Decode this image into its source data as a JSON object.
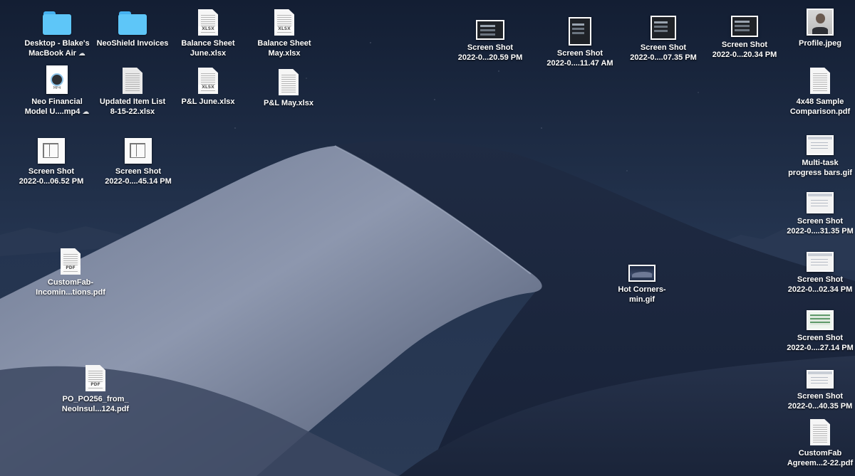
{
  "desktop": {
    "icons": {
      "desktop_folder": {
        "line1": "Desktop - Blake's",
        "line2": "MacBook Air",
        "type": "folder",
        "cloud": true
      },
      "neoshield_folder": {
        "line1": "NeoShield Invoices",
        "type": "folder"
      },
      "balance_june": {
        "line1": "Balance Sheet",
        "line2": "June.xlsx",
        "type": "xlsx",
        "badge": "XLSX"
      },
      "balance_may": {
        "line1": "Balance Sheet",
        "line2": "May.xlsx",
        "type": "xlsx",
        "badge": "XLSX"
      },
      "neo_model": {
        "line1": "Neo Financial",
        "line2": "Model U....mp4",
        "type": "mp4",
        "badge": "MP4",
        "cloud": true
      },
      "updated_item_list": {
        "line1": "Updated Item List",
        "line2": "8-15-22.xlsx",
        "type": "xlsx"
      },
      "pl_june": {
        "line1": "P&L June.xlsx",
        "type": "xlsx",
        "badge": "XLSX"
      },
      "pl_may": {
        "line1": "P&L May.xlsx",
        "type": "xlsx"
      },
      "shot_0652": {
        "line1": "Screen Shot",
        "line2": "2022-0...06.52 PM",
        "type": "screenshot"
      },
      "shot_4514": {
        "line1": "Screen Shot",
        "line2": "2022-0....45.14 PM",
        "type": "screenshot"
      },
      "customfab_incoming": {
        "line1": "CustomFab-",
        "line2": "Incomin...tions.pdf",
        "type": "pdf",
        "badge": "PDF"
      },
      "po_pdf": {
        "line1": "PO_PO256_from_",
        "line2": "NeoInsul...124.pdf",
        "type": "pdf",
        "badge": "PDF"
      },
      "shot_2059": {
        "line1": "Screen Shot",
        "line2": "2022-0...20.59 PM",
        "type": "screenshot"
      },
      "shot_1147": {
        "line1": "Screen Shot",
        "line2": "2022-0....11.47 AM",
        "type": "screenshot"
      },
      "shot_0735": {
        "line1": "Screen Shot",
        "line2": "2022-0....07.35 PM",
        "type": "screenshot"
      },
      "shot_2034": {
        "line1": "Screen Shot",
        "line2": "2022-0...20.34 PM",
        "type": "screenshot"
      },
      "profile": {
        "line1": "Profile.jpeg",
        "type": "jpeg"
      },
      "sample_pdf": {
        "line1": "4x48 Sample",
        "line2": "Comparison.pdf",
        "type": "pdf"
      },
      "multitask_gif": {
        "line1": "Multi-task",
        "line2": "progress bars.gif",
        "type": "gif"
      },
      "shot_3135": {
        "line1": "Screen Shot",
        "line2": "2022-0....31.35 PM",
        "type": "screenshot"
      },
      "shot_0234": {
        "line1": "Screen Shot",
        "line2": "2022-0...02.34 PM",
        "type": "screenshot"
      },
      "shot_2714": {
        "line1": "Screen Shot",
        "line2": "2022-0....27.14 PM",
        "type": "screenshot"
      },
      "shot_4035": {
        "line1": "Screen Shot",
        "line2": "2022-0...40.35 PM",
        "type": "screenshot"
      },
      "customfab_agreement": {
        "line1": "CustomFab",
        "line2": "Agreem...2-22.pdf",
        "type": "pdf"
      },
      "hot_corners": {
        "line1": "Hot Corners-",
        "line2": "min.gif",
        "type": "gif"
      }
    }
  },
  "colors": {
    "folder": "#5ec6f8",
    "sky_top": "#172338",
    "dune_light": "#8b95ad",
    "label_text": "#ffffff"
  },
  "icon_names": {
    "folder": "folder-icon",
    "document": "document-icon",
    "screenshot": "image-thumbnail-icon",
    "cloud": "icloud-icon"
  }
}
